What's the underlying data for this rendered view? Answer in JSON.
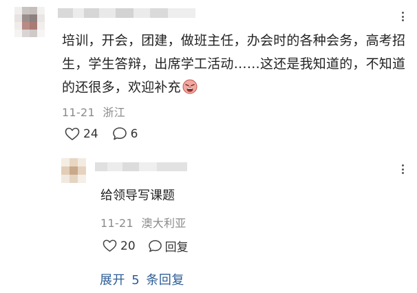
{
  "comment": {
    "text": "培训，开会，团建，做班主任，办会时的各种会务，高考招生，学生答辩，出席学工活动……这还是我知道的，不知道的还很多，欢迎补充",
    "emoji_icon": "weary-face-icon",
    "date": "11-21",
    "location": "浙江",
    "likes": "24",
    "replies": "6"
  },
  "reply": {
    "text": "给领导写课题",
    "date": "11-21",
    "location": "澳大利亚",
    "likes": "20",
    "reply_label": "回复"
  },
  "expand": {
    "prefix": "展开",
    "count": "5",
    "suffix": "条回复"
  },
  "colors": {
    "link": "#2c5c96",
    "meta": "#8a8a8a",
    "text": "#222222"
  }
}
